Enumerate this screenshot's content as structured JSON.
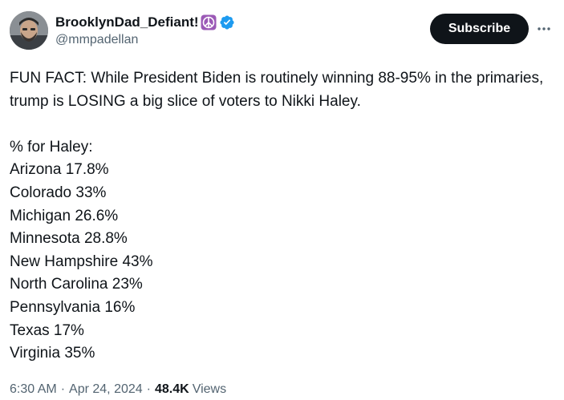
{
  "author": {
    "display_name": "BrooklynDad_Defiant!",
    "handle": "@mmpadellan",
    "badges": [
      "peace-symbol-emoji",
      "verified-badge"
    ],
    "verified_color": "#1d9bf0",
    "peace_badge_color": "#9b59b6"
  },
  "actions": {
    "subscribe_label": "Subscribe",
    "more_icon": "more-horizontal-icon"
  },
  "tweet": {
    "intro": "FUN FACT: While President Biden is routinely winning 88-95% in the primaries, trump is LOSING a big slice of voters to Nikki Haley.",
    "list_heading": "% for Haley:",
    "results": [
      {
        "state": "Arizona",
        "value": "17.8%"
      },
      {
        "state": "Colorado",
        "value": "33%"
      },
      {
        "state": "Michigan",
        "value": "26.6%"
      },
      {
        "state": "Minnesota",
        "value": "28.8%"
      },
      {
        "state": "New Hampshire",
        "value": "43%"
      },
      {
        "state": "North Carolina",
        "value": "23%"
      },
      {
        "state": "Pennsylvania",
        "value": "16%"
      },
      {
        "state": "Texas",
        "value": "17%"
      },
      {
        "state": "Virginia",
        "value": "35%"
      }
    ]
  },
  "meta": {
    "time": "6:30 AM",
    "separator": "·",
    "date": "Apr 24, 2024",
    "views_count": "48.4K",
    "views_label": "Views"
  }
}
